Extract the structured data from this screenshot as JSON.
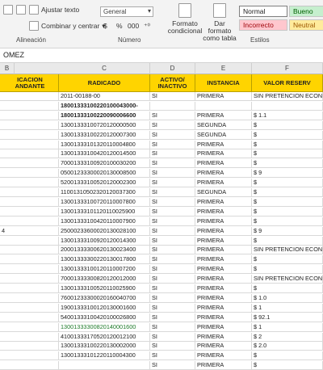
{
  "ribbon": {
    "alignment": {
      "wrap_text": "Ajustar texto",
      "merge_center": "Combinar y centrar",
      "group_name": "Alineación"
    },
    "number": {
      "format_value": "General",
      "currency": "$",
      "percent": "%",
      "comma": "000",
      "dec_inc": "←.0",
      ".dec_dec": ".00→",
      "group_name": "Número"
    },
    "styles": {
      "conditional": "Formato condicional",
      "as_table": "Dar formato como tabla",
      "normal": "Normal",
      "bueno": "Bueno",
      "incorrecto": "Incorrecto",
      "neutral": "Neutral",
      "group_name": "Estilos"
    }
  },
  "formula_bar": {
    "text": "OMEZ"
  },
  "columns": [
    {
      "letter": "B"
    },
    {
      "letter": "C"
    },
    {
      "letter": "D"
    },
    {
      "letter": "E"
    },
    {
      "letter": "F"
    }
  ],
  "table_header": {
    "b": "ICACION ANDANTE",
    "c": "RADICADO",
    "d": "ACTIVO/ INACTIVO",
    "e": "INSTANCIA",
    "f": "VALOR RESERV"
  },
  "rows": [
    {
      "b": "",
      "c": "2011-00188-00",
      "d": "SI",
      "e": "PRIMERA",
      "f": "SIN PRETENCION ECON"
    },
    {
      "b": "",
      "c": "18001333100220100043000-",
      "d": "",
      "e": "",
      "f": ""
    },
    {
      "b": "",
      "c": "18001333100220090006600",
      "d": "SI",
      "e": "PRIMERA",
      "f": "$                    1.1"
    },
    {
      "b": "",
      "c": "13001333100720120000500",
      "d": "SI",
      "e": "SEGUNDA",
      "f": "$"
    },
    {
      "b": "",
      "c": "13001333100220120007300",
      "d": "SI",
      "e": "SEGUNDA",
      "f": "$"
    },
    {
      "b": "",
      "c": "13001333101320110004800",
      "d": "SI",
      "e": "PRIMERA",
      "f": "$"
    },
    {
      "b": "",
      "c": "13001333100420120014500",
      "d": "SI",
      "e": "PRIMERA",
      "f": "$"
    },
    {
      "b": "",
      "c": "70001333100920100030200",
      "d": "SI",
      "e": "PRIMERA",
      "f": "$"
    },
    {
      "b": "",
      "c": "05001233300020130008500",
      "d": "SI",
      "e": "PRIMERA",
      "f": "$                        9"
    },
    {
      "b": "",
      "c": "52001333100520120002300",
      "d": "SI",
      "e": "PRIMERA",
      "f": "$"
    },
    {
      "b": "",
      "c": "11001310502320120037300",
      "d": "SI",
      "e": "SEGUNDA",
      "f": "$"
    },
    {
      "b": "",
      "c": "13001333100720110007800",
      "d": "SI",
      "e": "PRIMERA",
      "f": "$"
    },
    {
      "b": "",
      "c": "13001333101120110025900",
      "d": "SI",
      "e": "PRIMERA",
      "f": "$"
    },
    {
      "b": "",
      "c": "13001333100420110007900",
      "d": "SI",
      "e": "PRIMERA",
      "f": "$"
    },
    {
      "b": "4",
      "c": "25000233600020130028100",
      "d": "SI",
      "e": "PRIMERA",
      "f": "$                        9"
    },
    {
      "b": "",
      "c": "13001333100920120014300",
      "d": "SI",
      "e": "PRIMERA",
      "f": "$"
    },
    {
      "b": "",
      "c": "20001333300620130023400",
      "d": "SI",
      "e": "PRIMERA",
      "f": "SIN PRETENCION ECON"
    },
    {
      "b": "",
      "c": "13001333300220130017800",
      "d": "SI",
      "e": "PRIMERA",
      "f": "$"
    },
    {
      "b": "",
      "c": "13001333100120110007200",
      "d": "SI",
      "e": "PRIMERA",
      "f": "$"
    },
    {
      "b": "",
      "c": "70001333300820120012000",
      "d": "SI",
      "e": "PRIMERA",
      "f": "SIN PRETENCION ECON"
    },
    {
      "b": "",
      "c": "13001333100520110025900",
      "d": "SI",
      "e": "PRIMERA",
      "f": "$"
    },
    {
      "b": "",
      "c": "76001233300020160040700",
      "d": "SI",
      "e": "PRIMERA",
      "f": "$                    1.0"
    },
    {
      "b": "",
      "c": "19001333100120130001600",
      "d": "SI",
      "e": "PRIMERA",
      "f": "$                        1"
    },
    {
      "b": "",
      "c": "54001333100420100026800",
      "d": "SI",
      "e": "PRIMERA",
      "f": "$                    92.1"
    },
    {
      "b": "",
      "c": "13001333300820140001600",
      "d": "SI",
      "e": "PRIMERA",
      "f": "$                        1"
    },
    {
      "b": "",
      "c": "41001333170520120012100",
      "d": "SI",
      "e": "PRIMERA",
      "f": "$                        2"
    },
    {
      "b": "",
      "c": "13001333100220130002000",
      "d": "SI",
      "e": "PRIMERA",
      "f": "$                    2.0"
    },
    {
      "b": "",
      "c": "13001333101220110004300",
      "d": "SI",
      "e": "PRIMERA",
      "f": "$"
    },
    {
      "b": "",
      "c": "",
      "d": "SI",
      "e": "PRIMERA",
      "f": "$"
    }
  ]
}
